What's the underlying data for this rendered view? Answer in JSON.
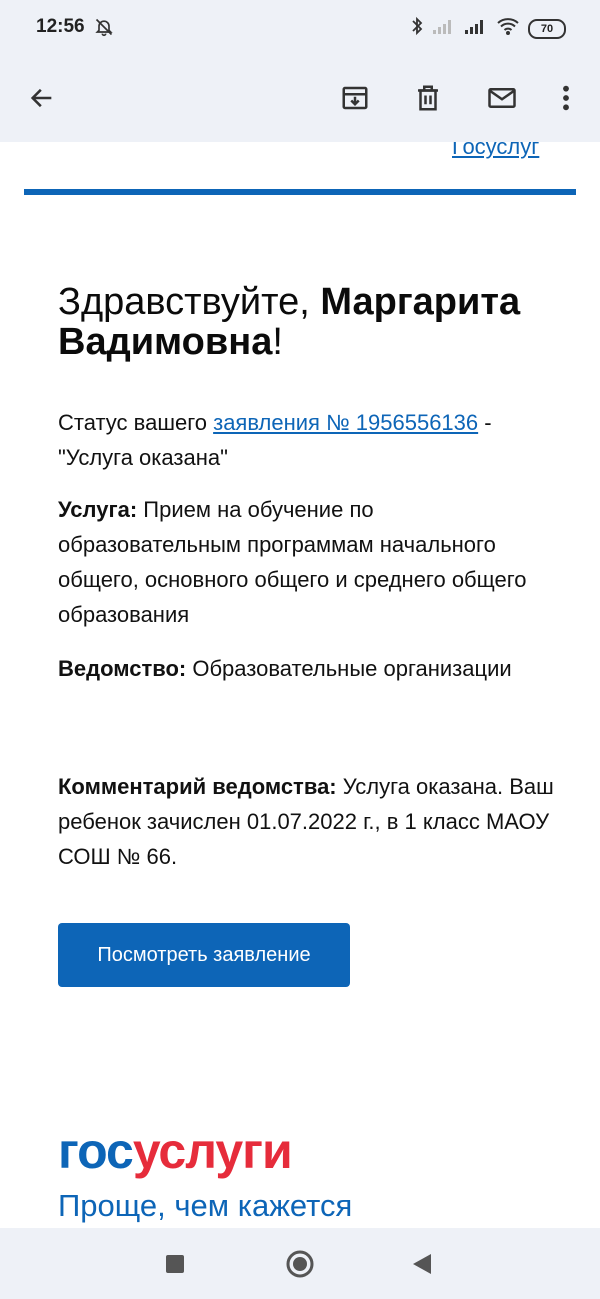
{
  "status_bar": {
    "time": "12:56",
    "battery": "70"
  },
  "toolbar": {
    "back_icon": "arrow-back-icon",
    "archive_icon": "archive-icon",
    "delete_icon": "trash-icon",
    "mark_unread_icon": "mail-icon",
    "more_icon": "more-vertical-icon"
  },
  "email": {
    "top_link": "Госуслуг",
    "greeting_prefix": "Здравствуйте, ",
    "greeting_name": "Маргарита Вадимовна",
    "greeting_suffix": "!",
    "status_prefix": "Статус вашего ",
    "status_link": "заявления № 1956556136",
    "status_suffix": " - \"Услуга оказана\"",
    "service_label": "Услуга:",
    "service_value": " Прием на обучение по образовательным программам начального общего, основного общего и среднего общего образования",
    "agency_label": "Ведомство:",
    "agency_value": " Образовательные организации",
    "comment_label": "Комментарий ведомства:",
    "comment_value": " Услуга оказана. Ваш ребенок зачислен 01.07.2022 г., в 1 класс МАОУ СОШ № 66.",
    "view_button": "Посмотреть заявление",
    "logo_part1": "гос",
    "logo_part2": "услуги",
    "slogan": "Проще, чем кажется"
  },
  "colors": {
    "brand_blue": "#0d65b7",
    "brand_red": "#e62c3b",
    "bar_bg": "#eef1f7"
  }
}
